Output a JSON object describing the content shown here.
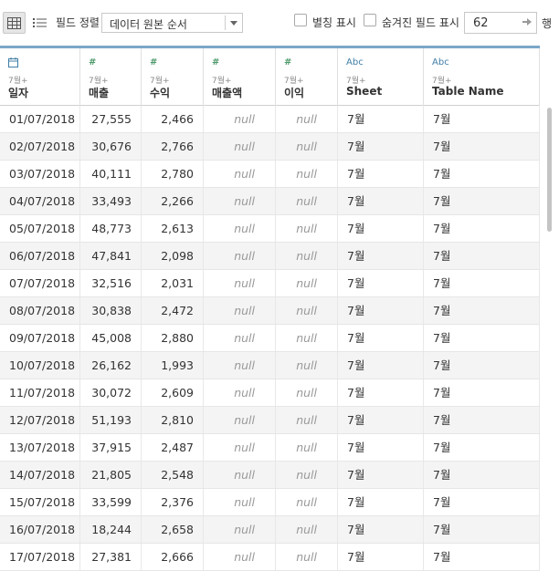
{
  "toolbar": {
    "sort_label": "필드 정렬",
    "sort_value": "데이터 원본 순서",
    "show_aliases_label": "별칭 표시",
    "show_hidden_label": "숨겨진 필드 표시",
    "rows_value": "62",
    "rows_unit": "행"
  },
  "columns": [
    {
      "type_icon": "calendar-icon",
      "source": "7월+",
      "name": "일자"
    },
    {
      "type_icon": "#",
      "source": "7월+",
      "name": "매출"
    },
    {
      "type_icon": "#",
      "source": "7월+",
      "name": "수익"
    },
    {
      "type_icon": "#",
      "source": "7월+",
      "name": "매출액"
    },
    {
      "type_icon": "#",
      "source": "7월+",
      "name": "이익"
    },
    {
      "type_icon": "Abc",
      "source": "7월+",
      "name": "Sheet"
    },
    {
      "type_icon": "Abc",
      "source": "7월+",
      "name": "Table Name"
    }
  ],
  "rows": [
    [
      "01/07/2018",
      "27,555",
      "2,466",
      "null",
      "null",
      "7월",
      "7월"
    ],
    [
      "02/07/2018",
      "30,676",
      "2,766",
      "null",
      "null",
      "7월",
      "7월"
    ],
    [
      "03/07/2018",
      "40,111",
      "2,780",
      "null",
      "null",
      "7월",
      "7월"
    ],
    [
      "04/07/2018",
      "33,493",
      "2,266",
      "null",
      "null",
      "7월",
      "7월"
    ],
    [
      "05/07/2018",
      "48,773",
      "2,613",
      "null",
      "null",
      "7월",
      "7월"
    ],
    [
      "06/07/2018",
      "47,841",
      "2,098",
      "null",
      "null",
      "7월",
      "7월"
    ],
    [
      "07/07/2018",
      "32,516",
      "2,031",
      "null",
      "null",
      "7월",
      "7월"
    ],
    [
      "08/07/2018",
      "30,838",
      "2,472",
      "null",
      "null",
      "7월",
      "7월"
    ],
    [
      "09/07/2018",
      "45,008",
      "2,880",
      "null",
      "null",
      "7월",
      "7월"
    ],
    [
      "10/07/2018",
      "26,162",
      "1,993",
      "null",
      "null",
      "7월",
      "7월"
    ],
    [
      "11/07/2018",
      "30,072",
      "2,609",
      "null",
      "null",
      "7월",
      "7월"
    ],
    [
      "12/07/2018",
      "51,193",
      "2,810",
      "null",
      "null",
      "7월",
      "7월"
    ],
    [
      "13/07/2018",
      "37,915",
      "2,487",
      "null",
      "null",
      "7월",
      "7월"
    ],
    [
      "14/07/2018",
      "21,805",
      "2,548",
      "null",
      "null",
      "7월",
      "7월"
    ],
    [
      "15/07/2018",
      "33,599",
      "2,376",
      "null",
      "null",
      "7월",
      "7월"
    ],
    [
      "16/07/2018",
      "18,244",
      "2,658",
      "null",
      "null",
      "7월",
      "7월"
    ],
    [
      "17/07/2018",
      "27,381",
      "2,666",
      "null",
      "null",
      "7월",
      "7월"
    ]
  ]
}
